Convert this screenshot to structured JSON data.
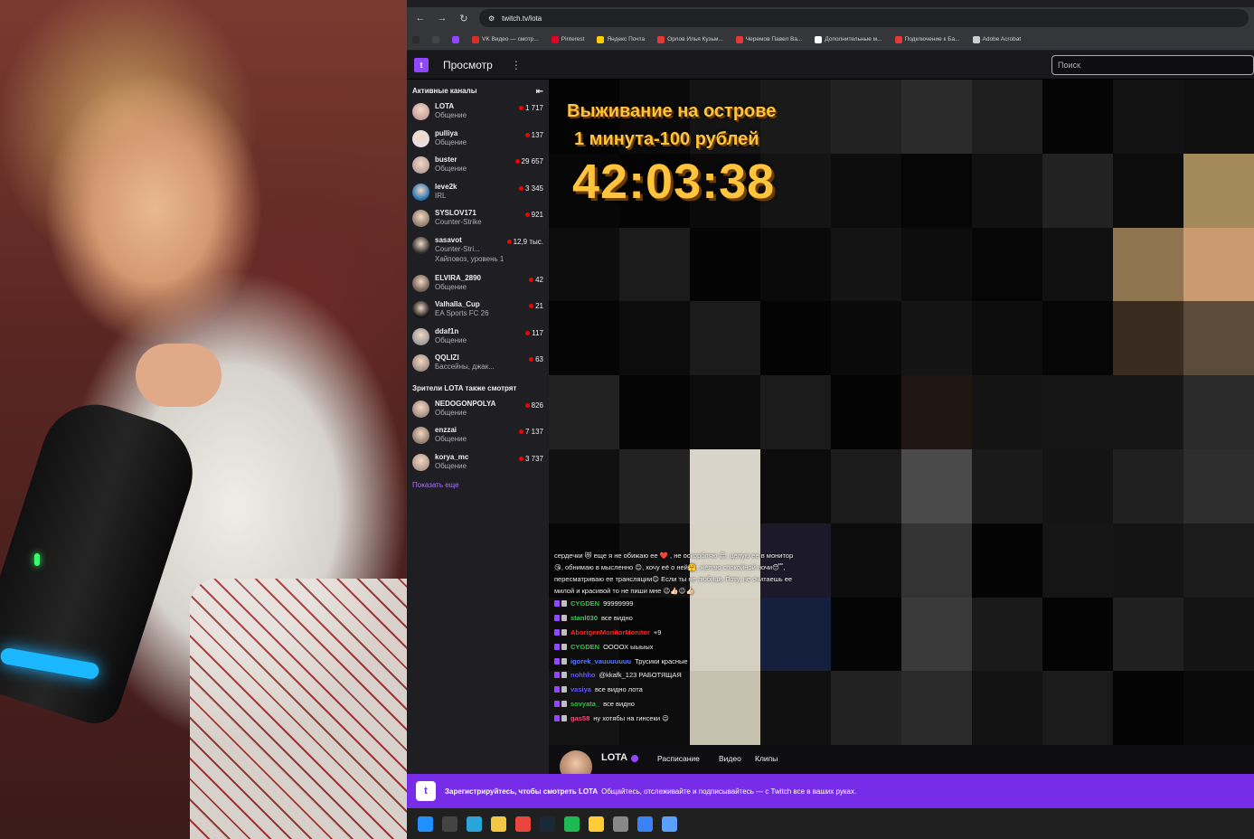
{
  "browser": {
    "url": "twitch.tv/lota",
    "nav": {
      "back": "←",
      "forward": "→",
      "reload": "↻"
    },
    "bookmarks": [
      {
        "label": "",
        "color": "#2b2b2b"
      },
      {
        "label": "",
        "color": "#444"
      },
      {
        "label": "",
        "color": "#9146ff"
      },
      {
        "label": "VK Видео — смотр...",
        "color": "#d93025"
      },
      {
        "label": "Pinterest",
        "color": "#e60023"
      },
      {
        "label": "Яндекс Почта",
        "color": "#ffcc00"
      },
      {
        "label": "Орлов Илья Кузьм...",
        "color": "#e53935"
      },
      {
        "label": "Черемов Павел Ва...",
        "color": "#e53935"
      },
      {
        "label": "Дополнительные м...",
        "color": "#ffffff"
      },
      {
        "label": "Подключение к Ба...",
        "color": "#e53935"
      },
      {
        "label": "Adobe Acrobat",
        "color": "#cccccc"
      }
    ]
  },
  "twitch": {
    "header": {
      "browse": "Просмотр",
      "more": "⋮",
      "search_placeholder": "Поиск"
    },
    "sidebar": {
      "active_title": "Активные каналы",
      "collapse": "⇤",
      "channels": [
        {
          "name": "LOTA",
          "game": "Общение",
          "viewers": "1 717",
          "color": "#c9a2a0"
        },
        {
          "name": "pulliya",
          "game": "Общение",
          "viewers": "137",
          "color": "#e8e0e6"
        },
        {
          "name": "buster",
          "game": "Общение",
          "viewers": "29 657",
          "color": "#b7a49e"
        },
        {
          "name": "leve2k",
          "game": "IRL",
          "viewers": "3 345",
          "color": "#1d6fb0"
        },
        {
          "name": "SYSLOV171",
          "game": "Counter-Strike",
          "viewers": "921",
          "color": "#8e7b6a"
        },
        {
          "name": "sasavot",
          "game": "Counter-Stri...",
          "viewers": "12,9 тыс.",
          "extra": "Хайповоз, уровень 1",
          "color": "#2b2b2b"
        },
        {
          "name": "ELVIRA_2890",
          "game": "Общение",
          "viewers": "42",
          "color": "#6b5b4f"
        },
        {
          "name": "Valhalla_Cup",
          "game": "EA Sports FC 26",
          "viewers": "21",
          "color": "#111111"
        },
        {
          "name": "ddaf1n",
          "game": "Общение",
          "viewers": "117",
          "color": "#9a9a9a"
        },
        {
          "name": "QQLIZI",
          "game": "Бассейны, джак...",
          "viewers": "63",
          "color": "#a08e84"
        }
      ],
      "also_watch_title": "Зрители LOTA также смотрят",
      "also": [
        {
          "name": "NEDOGONPOLYA",
          "game": "Общение",
          "viewers": "826",
          "color": "#a58c80"
        },
        {
          "name": "enzzai",
          "game": "Общение",
          "viewers": "7 137",
          "color": "#8f7c6a"
        },
        {
          "name": "korya_mc",
          "game": "Общение",
          "viewers": "3 737",
          "color": "#b09a8c"
        }
      ],
      "show_more": "Показать еще"
    },
    "overlay": {
      "title_line1": "Выживание на острове",
      "title_line2": "1 минута-100 рублей",
      "timer": "42:03:38"
    },
    "chat": {
      "intro": "сердечки 😻 еще я не обижаю ее ❤️ , не оскорбляю 😍, целую ее в монитор😘, обнимаю в мысленно 😊, хочу её о ней🤗, желаю спокойной ночи😴, пересматриваю ее трансляции😊 Если ты не любишь Лоту, не считаешь ее милой и красивой то не пиши мне 😉👍🏻😉👍🏻",
      "messages": [
        {
          "user": "CYGDEN",
          "text": "99999999",
          "color": "#2ecc40"
        },
        {
          "user": "stanl030",
          "text": "все видно",
          "color": "#3ad15a"
        },
        {
          "user": "AborigenMonitorMonitor",
          "text": "+9",
          "color": "#ff2a2a"
        },
        {
          "user": "CYGDEN",
          "text": "ООООХ ыыыых",
          "color": "#2ecc40"
        },
        {
          "user": "igorek_vauuuuuuu",
          "text": "Трусики красные",
          "color": "#5b7fff"
        },
        {
          "user": "nohhho",
          "text": "@kkafk_123 РАБОТЯЩАЯ",
          "color": "#6a5bff"
        },
        {
          "user": "vasiya",
          "text": "все видно лота",
          "color": "#6a5bff"
        },
        {
          "user": "sovyata_",
          "text": "все видно",
          "color": "#2ecc40"
        },
        {
          "user": "gas58",
          "text": "ну хотябы на гинсеки 😉",
          "color": "#ff4d7d"
        }
      ]
    },
    "info": {
      "name": "LOTA",
      "tabs": [
        "Расписание",
        "Видео",
        "Клипы"
      ]
    },
    "signup": {
      "bold": "Зарегистрируйтесь, чтобы смотреть LOTA",
      "text": "Общайтесь, отслеживайте и подписывайтесь — с Twitch все в ваших руках."
    }
  },
  "taskbar": {
    "icons": [
      {
        "name": "windows-start",
        "color": "#1e90ff"
      },
      {
        "name": "task-view",
        "color": "#444"
      },
      {
        "name": "edge",
        "color": "#2aa5d8"
      },
      {
        "name": "file-explorer",
        "color": "#f2c744"
      },
      {
        "name": "chrome",
        "color": "#e8453c"
      },
      {
        "name": "steam",
        "color": "#1b2838"
      },
      {
        "name": "spotify",
        "color": "#1db954"
      },
      {
        "name": "game",
        "color": "#ffcc33"
      },
      {
        "name": "clock",
        "color": "#888"
      },
      {
        "name": "app",
        "color": "#3b82f6"
      },
      {
        "name": "app2",
        "color": "#5aa0ff"
      }
    ]
  }
}
